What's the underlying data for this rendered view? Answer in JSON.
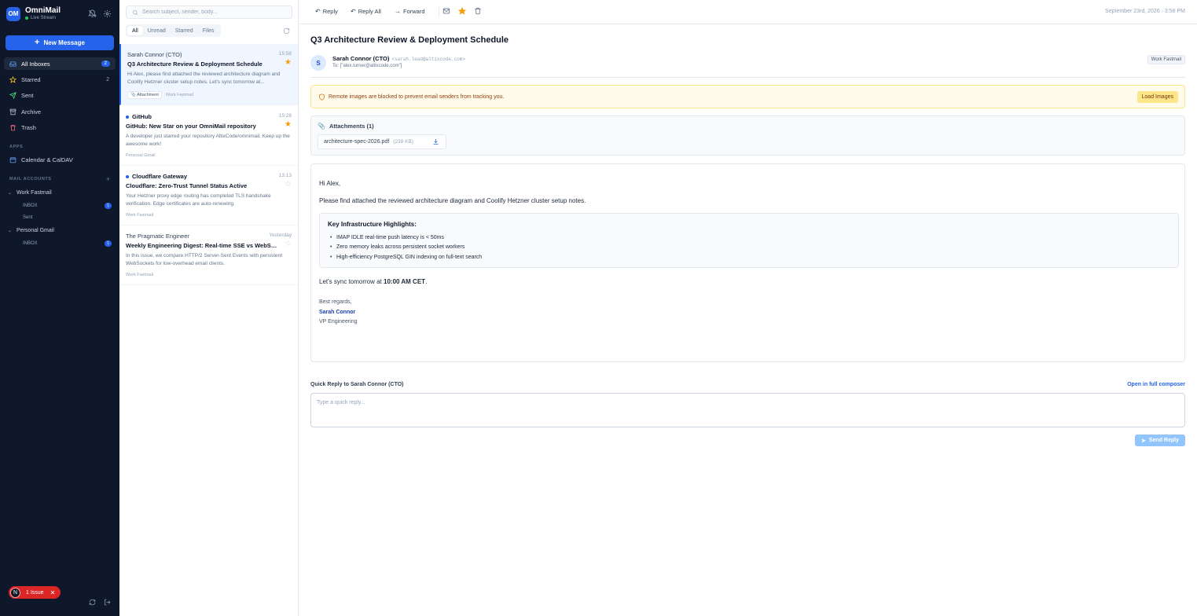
{
  "brand": {
    "logo": "OM",
    "name": "OmniMail",
    "status": "Live Stream"
  },
  "sidebar": {
    "new_message": "New Message",
    "nav": [
      {
        "label": "All Inboxes",
        "icon": "inbox-icon",
        "badge": "2"
      },
      {
        "label": "Starred",
        "icon": "star-icon",
        "count": "2"
      },
      {
        "label": "Sent",
        "icon": "send-icon"
      },
      {
        "label": "Archive",
        "icon": "archive-icon"
      },
      {
        "label": "Trash",
        "icon": "trash-icon"
      }
    ],
    "apps_title": "APPS",
    "apps": [
      {
        "label": "Calendar & CalDAV",
        "icon": "calendar-icon"
      }
    ],
    "accounts_title": "MAIL ACCOUNTS",
    "accounts": [
      {
        "name": "Work Fastmail",
        "folders": [
          {
            "label": "INBOX",
            "badge": "1"
          },
          {
            "label": "Sent"
          }
        ]
      },
      {
        "name": "Personal Gmail",
        "folders": [
          {
            "label": "INBOX",
            "badge": "1"
          }
        ]
      }
    ],
    "issue": {
      "avatar": "N",
      "label": "1 Issue"
    }
  },
  "list": {
    "search_placeholder": "Search subject, sender, body...",
    "tabs": [
      "All",
      "Unread",
      "Starred",
      "Files"
    ],
    "items": [
      {
        "sender": "Sarah Connor (CTO)",
        "time": "15:58",
        "subject": "Q3 Architecture Review & Deployment Schedule",
        "preview": "Hi Alex, please find attached the reviewed architecture diagram and Coolify Hetzner cluster setup notes. Let's sync tomorrow at...",
        "attachment": "Attachment",
        "account": "Work Fastmail",
        "starred": true,
        "unread": false
      },
      {
        "sender": "GitHub",
        "time": "15:28",
        "subject": "GitHub: New Star on your OmniMail repository",
        "preview": "A developer just starred your repository AltixCode/omnimail. Keep up the awesome work!",
        "account": "Personal Gmail",
        "starred": true,
        "unread": true
      },
      {
        "sender": "Cloudflare Gateway",
        "time": "13:13",
        "subject": "Cloudflare: Zero-Trust Tunnel Status Active",
        "preview": "Your Hetzner proxy edge routing has completed TLS handshake verification. Edge certificates are auto-renewing.",
        "account": "Work Fastmail",
        "starred": false,
        "unread": true
      },
      {
        "sender": "The Pragmatic Engineer",
        "time": "Yesterday",
        "subject": "Weekly Engineering Digest: Real-time SSE vs WebSockets",
        "preview": "In this issue, we compare HTTP/2 Server-Sent Events with persistent WebSockets for low-overhead email clients.",
        "account": "Work Fastmail",
        "starred": false,
        "unread": false
      }
    ]
  },
  "reader": {
    "toolbar": {
      "reply": "Reply",
      "reply_all": "Reply All",
      "forward": "Forward",
      "date": "September 23rd, 2026 · 3:58 PM"
    },
    "subject": "Q3 Architecture Review & Deployment Schedule",
    "sender": {
      "initial": "S",
      "name": "Sarah Connor (CTO)",
      "email": "<sarah.lead@altixcode.com>",
      "to": "To: [\"alex.turner@altixcode.com\"]",
      "account": "Work Fastmail"
    },
    "warning": {
      "text": "Remote images are blocked to prevent email senders from tracking you.",
      "button": "Load Images"
    },
    "attachments": {
      "title": "Attachments (1)",
      "file": "architecture-spec-2026.pdf",
      "size": "(239 KB)"
    },
    "body": {
      "greeting": "Hi Alex,",
      "intro": "Please find attached the reviewed architecture diagram and Coolify Hetzner cluster setup notes.",
      "highlights_title": "Key Infrastructure Highlights:",
      "highlights": [
        "IMAP IDLE real-time push latency is < 50ms",
        "Zero memory leaks across persistent socket workers",
        "High-efficiency PostgreSQL GIN indexing on full-text search"
      ],
      "sync_prefix": "Let's sync tomorrow at ",
      "sync_time": "10:00 AM CET",
      "sync_suffix": ".",
      "closing": "Best regards,",
      "sig_name": "Sarah Connor",
      "sig_title": "VP Engineering"
    },
    "quick_reply": {
      "label": "Quick Reply to Sarah Connor (CTO)",
      "open_full": "Open in full composer",
      "placeholder": "Type a quick reply...",
      "send": "Send Reply"
    }
  },
  "colors": {
    "sidebar_bg": "#0f172a",
    "accent": "#2563eb",
    "star": "#f59e0b",
    "warning_bg": "#fffbeb",
    "issue": "#dc2626"
  }
}
